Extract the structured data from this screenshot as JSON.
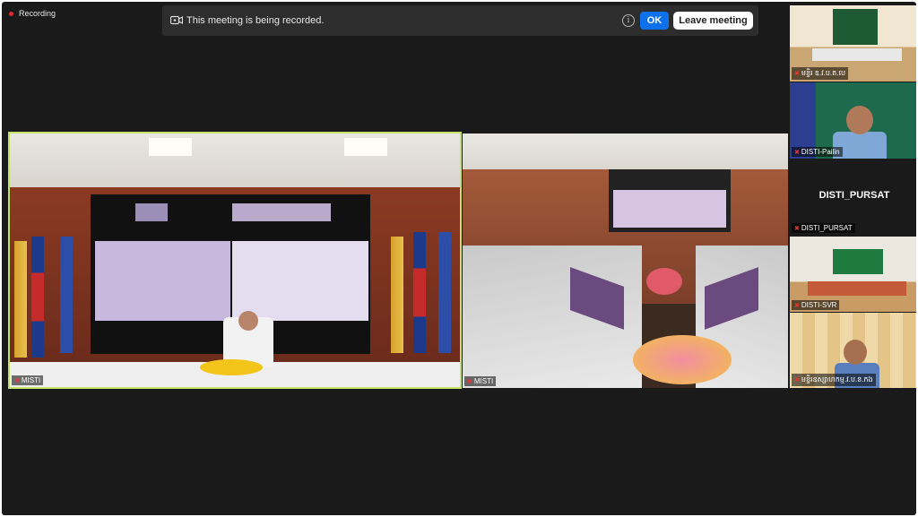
{
  "recording": {
    "label": "Recording"
  },
  "banner": {
    "message": "This meeting is being recorded.",
    "ok_label": "OK",
    "leave_label": "Leave meeting"
  },
  "tiles": {
    "main1": {
      "name": "MISTI"
    },
    "main2": {
      "name": "MISTI"
    },
    "side1": {
      "name": "មន្ទីរ ឧ.វ.ប.ត.បេ"
    },
    "side2": {
      "name": "DISTI-Pailin"
    },
    "side3": {
      "name": "DISTI_PURSAT",
      "display_name": "DISTI_PURSAT"
    },
    "side4": {
      "name": "DISTI-SVR"
    },
    "side5": {
      "name": "មន្ទីរឧស្សាហកម្ម.វ.ប.ន.កង"
    }
  },
  "colors": {
    "active_speaker_border": "#c5e36a",
    "ok_button": "#0e71eb",
    "recording_dot": "#e02b2b"
  }
}
